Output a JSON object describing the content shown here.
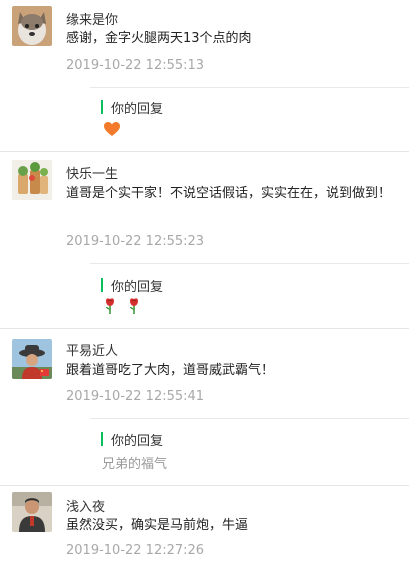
{
  "comments": [
    {
      "name": "缘来是你",
      "content": "感谢，金字火腿两天13个点的肉",
      "time": "2019-10-22 12:55:13",
      "reply_label": "你的回复",
      "reply_icon": "heart-emoji"
    },
    {
      "name": "快乐一生",
      "content": "道哥是个实干家！不说空话假话，实实在在，说到做到！",
      "time": "2019-10-22 12:55:23",
      "reply_label": "你的回复",
      "reply_icon": "rose-emoji"
    },
    {
      "name": "平易近人",
      "content": "跟着道哥吃了大肉，道哥威武霸气！",
      "time": "2019-10-22 12:55:41",
      "reply_label": "你的回复",
      "reply_text": "兄弟的福气"
    },
    {
      "name": "浅入夜",
      "content": "虽然没买，确实是马前炮，牛逼",
      "time": "2019-10-22 12:27:26"
    }
  ],
  "colors": {
    "accent": "#07c160",
    "time_text": "#a8a8a8",
    "reply_text": "#999999",
    "divider": "#e6e6e6"
  }
}
